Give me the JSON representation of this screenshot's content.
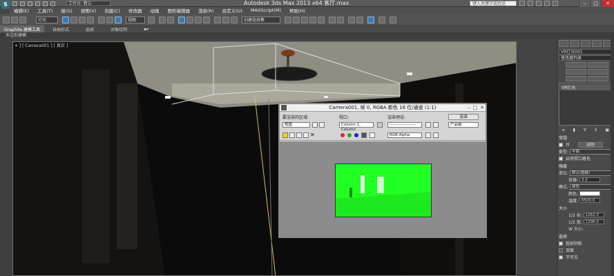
{
  "app": {
    "window_title": "Autodesk 3ds Max  2013 x64      客厅.max",
    "workspace_label": "工作台: 默认",
    "search_placeholder": "键入关键字或短语",
    "logo_letter": "S"
  },
  "menu": [
    "编辑(E)",
    "工具(T)",
    "组(G)",
    "视图(V)",
    "创建(C)",
    "修改器",
    "动画",
    "图形编辑器",
    "渲染(R)",
    "自定义(U)",
    "MAXScript(M)",
    "帮助(H)"
  ],
  "toolbar": {
    "selection_filter": "灯光",
    "ref_coord": "视图",
    "named_selection": "创建选择集"
  },
  "ribbon": {
    "tabs": [
      "Graphite 建模工具",
      "自由形式",
      "选择",
      "对象绘制"
    ],
    "sub_label": "多边形建模"
  },
  "viewport": {
    "label": "+ ] [ Camera001 ] [ 真实 ]"
  },
  "render_window": {
    "title": "Camera001, 帧 0, RGBA 颜色 16 位/通道 (1:1)",
    "area_label": "要渲染的区域:",
    "area_value": "视图",
    "viewport_label": "视口:",
    "viewport_value": "Column 1, Column",
    "preset_label": "渲染预设:",
    "preset_value": "-------------------",
    "render_button": "渲染",
    "product_value": "产品级",
    "channel_value": "RGB Alpha"
  },
  "right_panel": {
    "object_name": "VR灯光001",
    "modifier_list": "修改器列表",
    "stack_item": "VR灯光",
    "section_general": "常规",
    "on_label": "开",
    "exclude_button": "排除",
    "type_label": "类型:",
    "type_value": "平面",
    "portal_label": "启用视口着色",
    "intensity_section": "强度",
    "units_label": "单位:",
    "units_value": "默认(图像)",
    "multiplier_label": "倍增:",
    "multiplier_value": "3.0",
    "mode_label": "模式:",
    "mode_value": "颜色",
    "temp_label": "温度:",
    "temp_value": "6500.0",
    "size_section": "大小",
    "half_length_label": "1/2 长:",
    "half_length_value": "1262.0",
    "half_width_label": "1/2 宽:",
    "half_width_value": "1206.0",
    "w_label": "W 大小:",
    "options_section": "选项",
    "cast_shadows": "投射阴影",
    "double_sided": "双面",
    "invisible": "不可见"
  },
  "colors": {
    "render_green": "#22ff22",
    "accent_blue": "#3d7ab3"
  }
}
